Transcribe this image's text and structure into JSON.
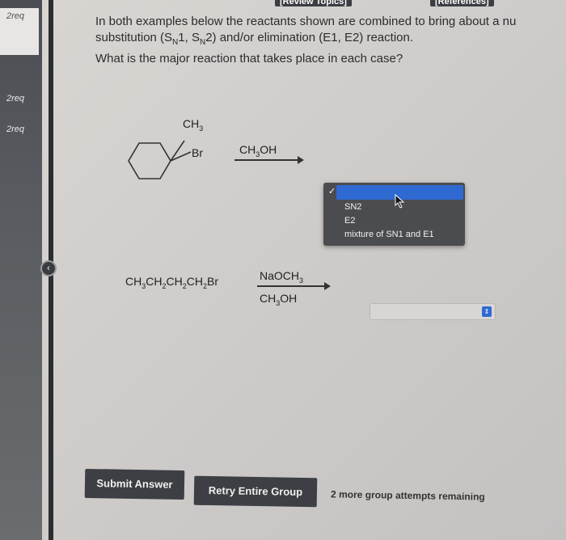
{
  "top_links": {
    "review": "[Review Topics]",
    "references": "[References]"
  },
  "sidebar": {
    "items": [
      {
        "label": "2req"
      },
      {
        "label": "2req"
      },
      {
        "label": "2req"
      }
    ]
  },
  "question": {
    "line1": "In both examples below the reactants shown are combined to bring about a nu",
    "line2_pre": "substitution (S",
    "line2_sub1": "N",
    "line2_mid1": "1, S",
    "line2_sub2": "N",
    "line2_post": "2) and/or elimination (E1, E2) reaction.",
    "line3": "What is the major reaction that takes place in each case?"
  },
  "reaction1": {
    "methyl_label": "CH",
    "methyl_sub": "3",
    "bromo_label": "Br",
    "solvent": "CH",
    "solvent_sub": "3",
    "solvent_post": "OH"
  },
  "reaction2": {
    "substrate": "CH3CH2CH2CH2Br",
    "reagent_top": "NaOCH3",
    "reagent_bottom": "CH3OH"
  },
  "dropdown": {
    "options": [
      "SN2",
      "E2",
      "mixture of SN1 and E1"
    ],
    "selected_value": ""
  },
  "select2": {
    "value": ""
  },
  "buttons": {
    "submit": "Submit Answer",
    "retry": "Retry Entire Group"
  },
  "attempts_text": "2 more group attempts remaining",
  "colors": {
    "accent": "#2f6ad2",
    "sidebar": "#4a4d52",
    "button": "#3d3f44"
  }
}
